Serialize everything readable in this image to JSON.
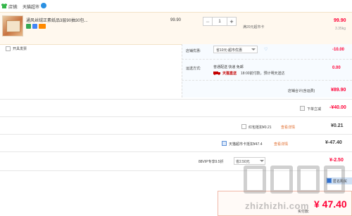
{
  "store": {
    "label": "店铺:",
    "name": "天猫超市"
  },
  "product": {
    "title": "通风丝绒正素纸品3层90抽30包...",
    "unit_price": "99.90",
    "quantity": "1",
    "promo_note": "满20元超市卡",
    "line_price": "99.90",
    "weight": "3.35kg",
    "tag_colors": [
      "#34a853",
      "#4285f4",
      "#ff8a00"
    ]
  },
  "invoice": {
    "label": "开具发票"
  },
  "coupon": {
    "label": "店铺优惠:",
    "selected": "省10元:超市优惠",
    "amount": "-10.00"
  },
  "shipping": {
    "label": "运送方式:",
    "mode": "普通配送 快递 免邮",
    "badge": "天猫直送",
    "eta": "18:00前付款，预计明天送达",
    "fee": "0.00"
  },
  "store_total": {
    "label": "店铺合计(含运费)",
    "amount": "¥89.90"
  },
  "rows": {
    "full_discount": {
      "label": "下单立减",
      "amount": "-¥40.00"
    },
    "redpacket": {
      "label": "红包抵扣¥0.21",
      "link": "查看详情",
      "amount": "¥0.21"
    },
    "tmall_card": {
      "label": "天猫超市卡抵扣¥47.4",
      "link": "查看详情",
      "amount": "¥-47.40"
    },
    "vip": {
      "label": "88VIP专享9.5折",
      "selected": "省2.50元",
      "amount": "¥-2.50"
    }
  },
  "anonymous": {
    "label": "匿名购买"
  },
  "payment": {
    "label": "实付款:",
    "amount": "¥ 47.40"
  },
  "watermark": {
    "text": "zhizhizhi.com"
  }
}
